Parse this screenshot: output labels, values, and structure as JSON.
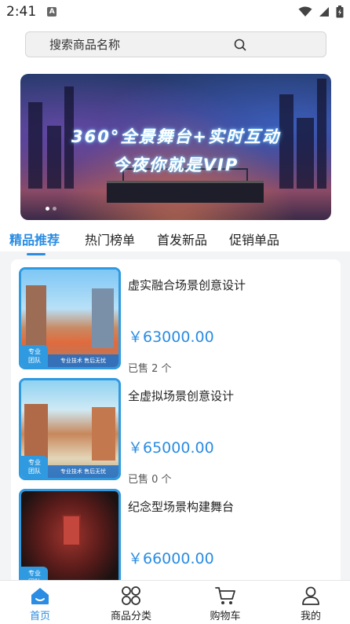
{
  "status_bar": {
    "time": "2:41",
    "notification_badge": "A"
  },
  "search": {
    "placeholder": "搜索商品名称"
  },
  "banner": {
    "line1": "360°全景舞台+实时互动",
    "line2": "今夜你就是VIP",
    "slide_count": 2,
    "active_slide": 1
  },
  "tabs": [
    {
      "label": "精品推荐",
      "active": true
    },
    {
      "label": "热门榜单",
      "active": false
    },
    {
      "label": "首发新品",
      "active": false
    },
    {
      "label": "促销单品",
      "active": false
    }
  ],
  "products": [
    {
      "title": "虚实融合场景创意设计",
      "price": "￥63000.00",
      "sold": "已售 2 个",
      "badge_line1": "专业",
      "badge_line2": "团队",
      "strip_text": "专业技术 售后无忧"
    },
    {
      "title": "全虚拟场景创意设计",
      "price": "￥65000.00",
      "sold": "已售 0 个",
      "badge_line1": "专业",
      "badge_line2": "团队",
      "strip_text": "专业技术 售后无忧"
    },
    {
      "title": "纪念型场景构建舞台",
      "price": "￥66000.00",
      "sold": "",
      "badge_line1": "专业",
      "badge_line2": "团队",
      "strip_text": ""
    }
  ],
  "bottom_nav": [
    {
      "label": "首页",
      "icon": "home-icon",
      "active": true
    },
    {
      "label": "商品分类",
      "icon": "category-icon",
      "active": false
    },
    {
      "label": "购物车",
      "icon": "cart-icon",
      "active": false
    },
    {
      "label": "我的",
      "icon": "user-icon",
      "active": false
    }
  ],
  "colors": {
    "accent": "#2a8ce2",
    "thumb_border": "#2f9ae0",
    "background": "#f3f4f6"
  }
}
